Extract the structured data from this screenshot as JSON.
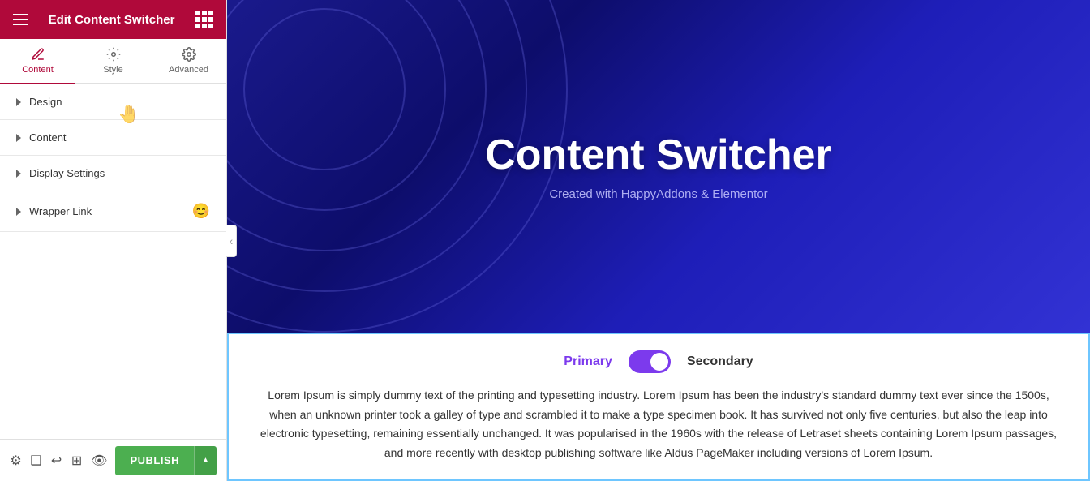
{
  "sidebar": {
    "header": {
      "title": "Edit Content Switcher"
    },
    "tabs": [
      {
        "id": "content",
        "label": "Content",
        "active": true
      },
      {
        "id": "style",
        "label": "Style",
        "active": false
      },
      {
        "id": "advanced",
        "label": "Advanced",
        "active": false
      }
    ],
    "accordion": [
      {
        "id": "design",
        "label": "Design"
      },
      {
        "id": "content",
        "label": "Content"
      },
      {
        "id": "display-settings",
        "label": "Display Settings"
      },
      {
        "id": "wrapper-link",
        "label": "Wrapper Link",
        "hasEmoji": true,
        "emoji": "😊"
      }
    ],
    "footer": {
      "icons": [
        "settings",
        "layers",
        "history",
        "templates",
        "preview"
      ],
      "publish_label": "PUBLISH"
    }
  },
  "hero": {
    "title": "Content Switcher",
    "subtitle": "Created with HappyAddons & Elementor"
  },
  "switcher": {
    "primary_label": "Primary",
    "secondary_label": "Secondary",
    "content": "Lorem Ipsum is simply dummy text of the printing and typesetting industry. Lorem Ipsum has been the industry's standard dummy text ever since the 1500s, when an unknown printer took a galley of type and scrambled it to make a type specimen book. It has survived not only five centuries, but also the leap into electronic typesetting, remaining essentially unchanged. It was popularised in the 1960s with the release of Letraset sheets containing Lorem Ipsum passages, and more recently with desktop publishing software like Aldus PageMaker including versions of Lorem Ipsum."
  },
  "colors": {
    "header_bg": "#b0093a",
    "tab_active": "#b0093a",
    "toggle_bg": "#7c3aed",
    "primary_label": "#7c3aed",
    "publish_btn": "#4CAF50",
    "hero_bg_start": "#0d0d6b",
    "hero_bg_end": "#3232d4",
    "border_highlight": "#6ec6ff"
  }
}
